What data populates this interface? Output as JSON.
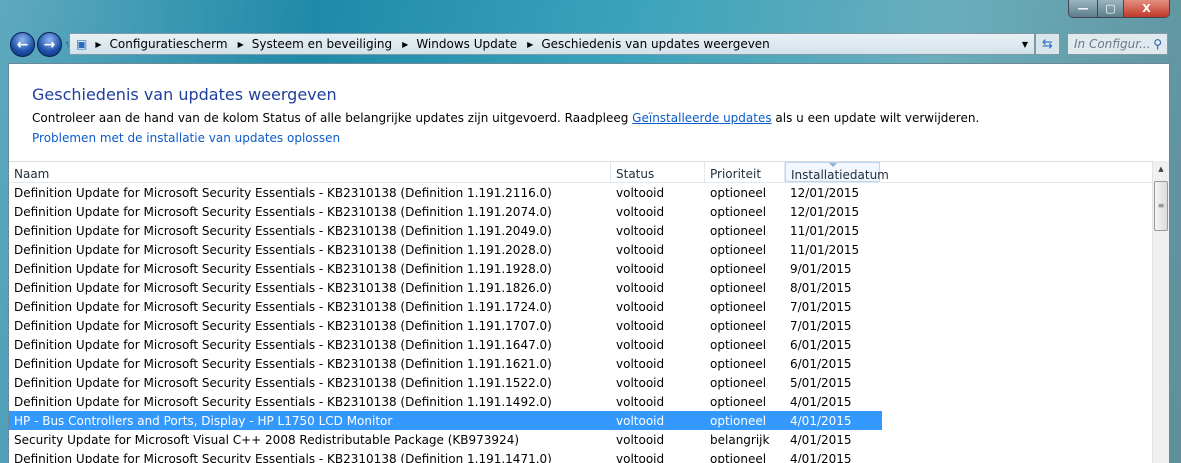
{
  "window": {
    "minimize": "—",
    "maximize": "▢",
    "close": "X"
  },
  "address": {
    "crumbs": [
      "Configuratiescherm",
      "Systeem en beveiliging",
      "Windows Update",
      "Geschiedenis van updates weergeven"
    ]
  },
  "search": {
    "placeholder": "In Configur..."
  },
  "page": {
    "title": "Geschiedenis van updates weergeven",
    "desc_before": "Controleer aan de hand van de kolom Status of alle belangrijke updates zijn uitgevoerd. Raadpleeg ",
    "desc_link": "Geïnstalleerde updates",
    "desc_after": " als u een update wilt verwijderen.",
    "help_link": "Problemen met de installatie van updates oplossen"
  },
  "table": {
    "columns": [
      "Naam",
      "Status",
      "Prioriteit",
      "Installatiedatum"
    ],
    "sorted_column": "Installatiedatum",
    "selected_row": 12,
    "rows": [
      [
        "Definition Update for Microsoft Security Essentials - KB2310138 (Definition 1.191.2116.0)",
        "voltooid",
        "optioneel",
        "12/01/2015"
      ],
      [
        "Definition Update for Microsoft Security Essentials - KB2310138 (Definition 1.191.2074.0)",
        "voltooid",
        "optioneel",
        "12/01/2015"
      ],
      [
        "Definition Update for Microsoft Security Essentials - KB2310138 (Definition 1.191.2049.0)",
        "voltooid",
        "optioneel",
        "11/01/2015"
      ],
      [
        "Definition Update for Microsoft Security Essentials - KB2310138 (Definition 1.191.2028.0)",
        "voltooid",
        "optioneel",
        "11/01/2015"
      ],
      [
        "Definition Update for Microsoft Security Essentials - KB2310138 (Definition 1.191.1928.0)",
        "voltooid",
        "optioneel",
        "9/01/2015"
      ],
      [
        "Definition Update for Microsoft Security Essentials - KB2310138 (Definition 1.191.1826.0)",
        "voltooid",
        "optioneel",
        "8/01/2015"
      ],
      [
        "Definition Update for Microsoft Security Essentials - KB2310138 (Definition 1.191.1724.0)",
        "voltooid",
        "optioneel",
        "7/01/2015"
      ],
      [
        "Definition Update for Microsoft Security Essentials - KB2310138 (Definition 1.191.1707.0)",
        "voltooid",
        "optioneel",
        "7/01/2015"
      ],
      [
        "Definition Update for Microsoft Security Essentials - KB2310138 (Definition 1.191.1647.0)",
        "voltooid",
        "optioneel",
        "6/01/2015"
      ],
      [
        "Definition Update for Microsoft Security Essentials - KB2310138 (Definition 1.191.1621.0)",
        "voltooid",
        "optioneel",
        "6/01/2015"
      ],
      [
        "Definition Update for Microsoft Security Essentials - KB2310138 (Definition 1.191.1522.0)",
        "voltooid",
        "optioneel",
        "5/01/2015"
      ],
      [
        "Definition Update for Microsoft Security Essentials - KB2310138 (Definition 1.191.1492.0)",
        "voltooid",
        "optioneel",
        "4/01/2015"
      ],
      [
        "HP - Bus Controllers and Ports, Display - HP L1750 LCD Monitor",
        "voltooid",
        "optioneel",
        "4/01/2015"
      ],
      [
        "Security Update for Microsoft Visual C++ 2008 Redistributable Package (KB973924)",
        "voltooid",
        "belangrijk",
        "4/01/2015"
      ],
      [
        "Definition Update for Microsoft Security Essentials - KB2310138 (Definition 1.191.1471.0)",
        "voltooid",
        "optioneel",
        "4/01/2015"
      ]
    ]
  }
}
